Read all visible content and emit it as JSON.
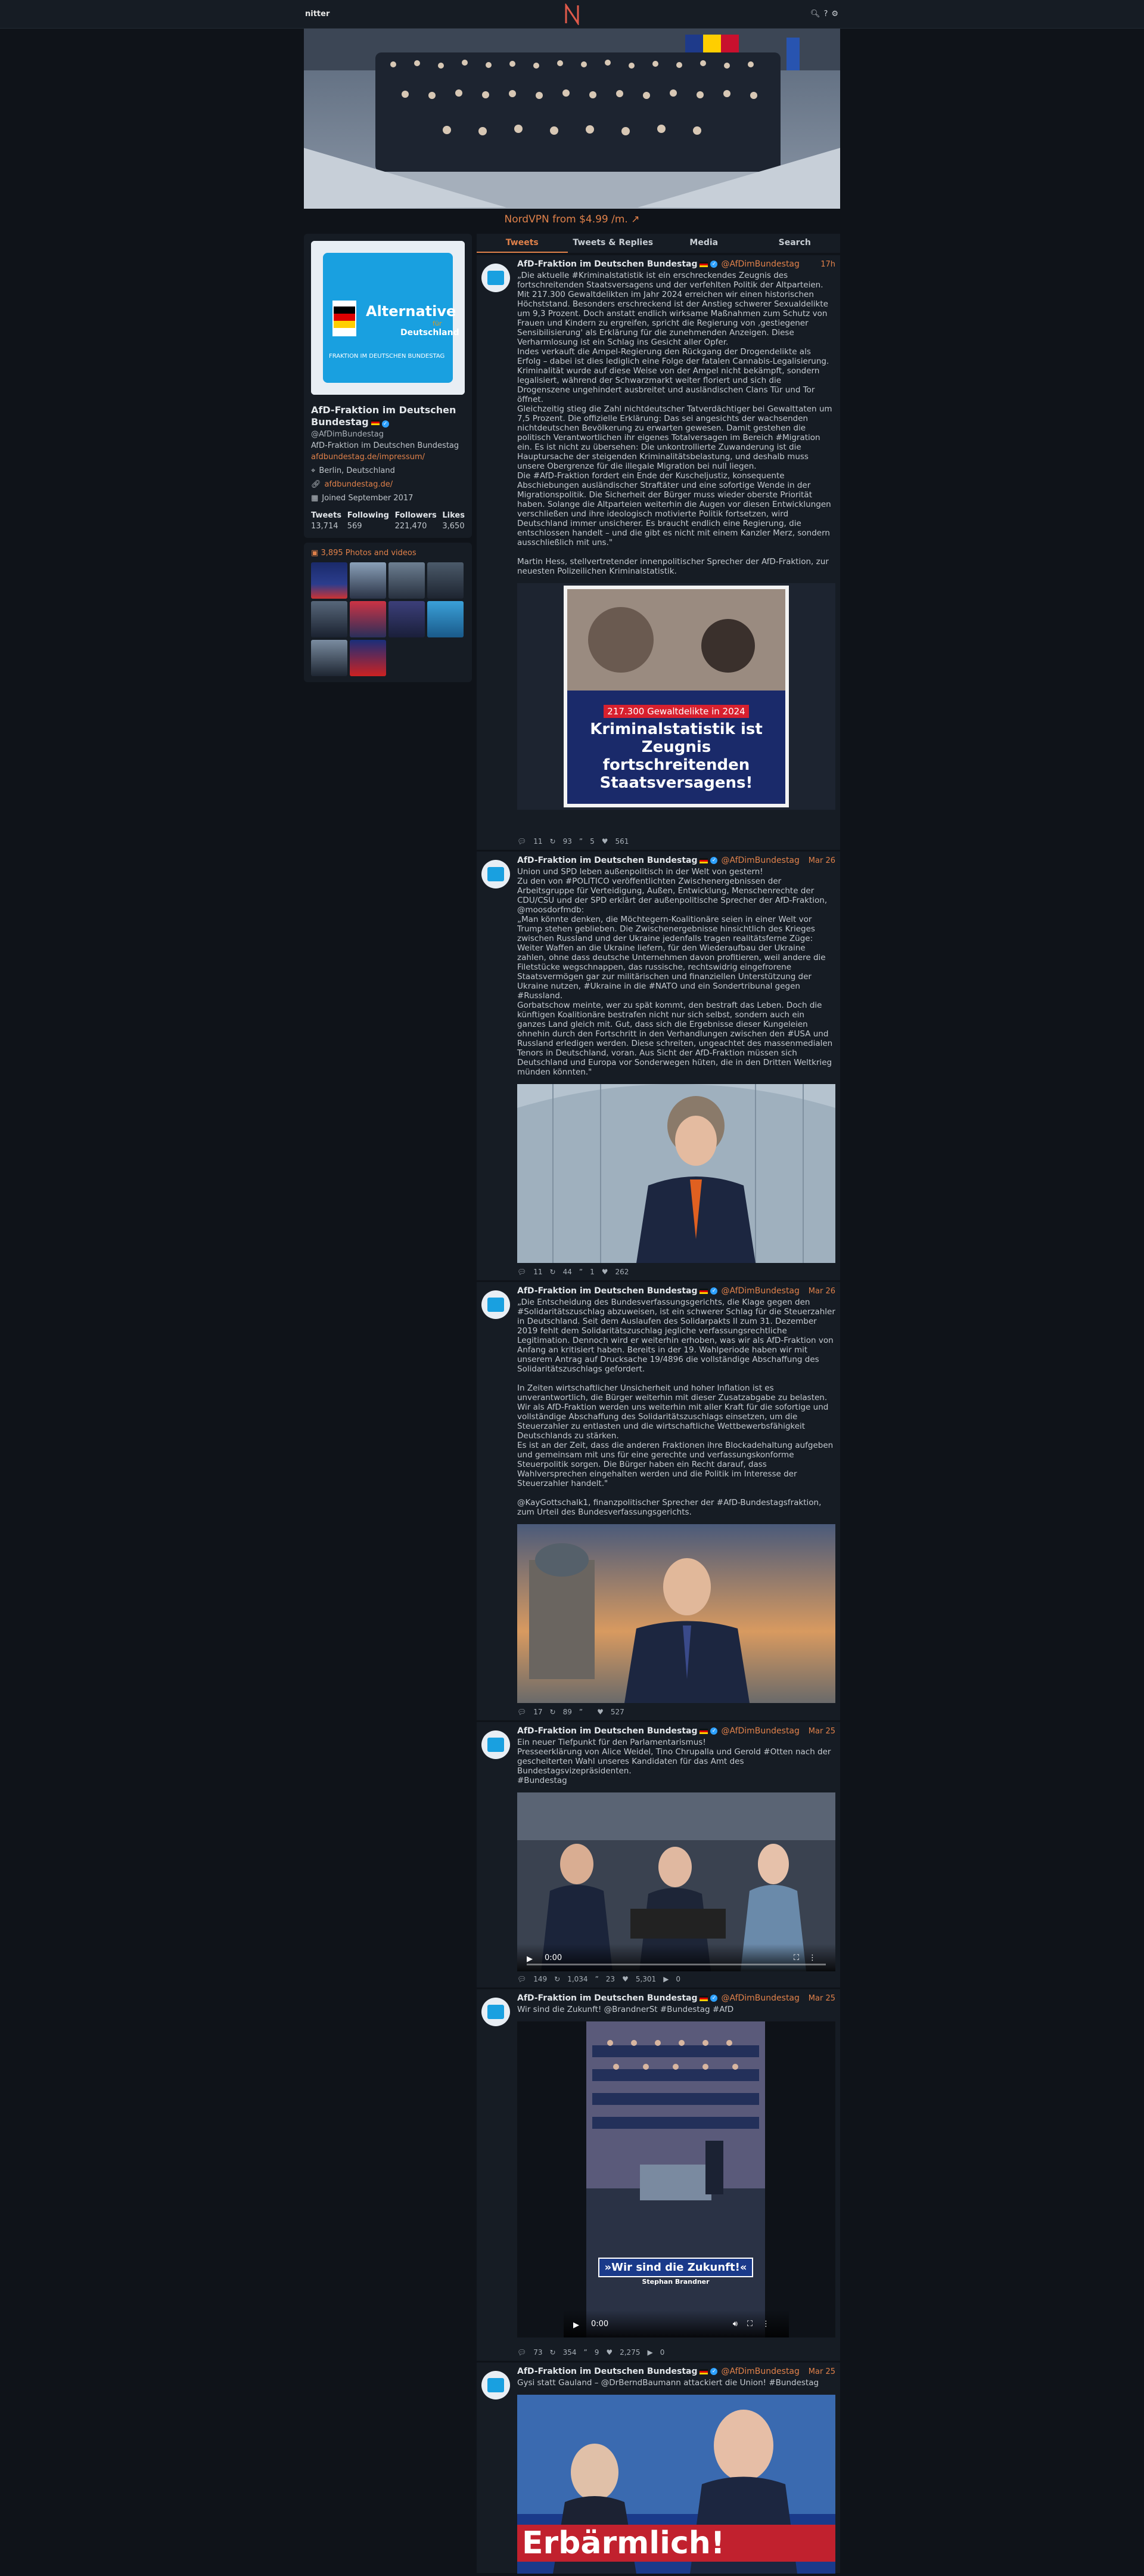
{
  "nav": {
    "brand": "nitter",
    "logo": "N",
    "icons": [
      "search-icon",
      "help-icon",
      "settings-icon"
    ]
  },
  "ad": {
    "text": "NordVPN from $4.99 /m.",
    "icon": "external-link-icon"
  },
  "profile": {
    "name": "AfD-Fraktion im Deutschen Bundestag",
    "handle": "@AfDimBundestag",
    "bio": "AfD-Fraktion im Deutschen Bundestag",
    "bio_link": "afdbundestag.de/impressum/",
    "location": "Berlin, Deutschland",
    "website": "afdbundestag.de/",
    "joined": "Joined September 2017",
    "stats": [
      {
        "label": "Tweets",
        "value": "13,714"
      },
      {
        "label": "Following",
        "value": "569"
      },
      {
        "label": "Followers",
        "value": "221,470"
      },
      {
        "label": "Likes",
        "value": "3,650"
      }
    ],
    "avatar_text": {
      "line1": "Alternative",
      "line2": "für",
      "line3": "Deutschland",
      "footer": "FRAKTION IM DEUTSCHEN BUNDESTAG"
    }
  },
  "media": {
    "title": "3,895 Photos and videos"
  },
  "tabs": [
    "Tweets",
    "Tweets & Replies",
    "Media",
    "Search"
  ],
  "colors": {
    "accent": "#e0814a",
    "bg": "#0f1319",
    "panel": "#161c24"
  },
  "tweets": [
    {
      "name": "AfD-Fraktion im Deutschen Bundestag",
      "handle": "@AfDimBundestag",
      "date": "17h",
      "text": "„Die aktuelle #Kriminalstatistik ist ein erschreckendes Zeugnis des fortschreitenden Staatsversagens und der verfehlten Politik der Altparteien. Mit 217.300 Gewaltdelikten im Jahr 2024 erreichen wir einen historischen Höchststand. Besonders erschreckend ist der Anstieg schwerer Sexualdelikte um 9,3 Prozent. Doch anstatt endlich wirksame Maßnahmen zum Schutz von Frauen und Kindern zu ergreifen, spricht die Regierung von ‚gestiegener Sensibilisierung' als Erklärung für die zunehmenden Anzeigen. Diese Verharmlosung ist ein Schlag ins Gesicht aller Opfer.\nIndes verkauft die Ampel-Regierung den Rückgang der Drogendelikte als Erfolg – dabei ist dies lediglich eine Folge der fatalen Cannabis-Legalisierung. Kriminalität wurde auf diese Weise von der Ampel nicht bekämpft, sondern legalisiert, während der Schwarzmarkt weiter floriert und sich die Drogenszene ungehindert ausbreitet und ausländischen Clans Tür und Tor öffnet.\nGleichzeitig stieg die Zahl nichtdeutscher Tatverdächtiger bei Gewalttaten um 7,5 Prozent. Die offizielle Erklärung: Das sei angesichts der wachsenden nichtdeutschen Bevölkerung zu erwarten gewesen. Damit gestehen die politisch Verantwortlichen ihr eigenes Totalversagen im Bereich #Migration ein. Es ist nicht zu übersehen: Die unkontrollierte Zuwanderung ist die Hauptursache der steigenden Kriminalitätsbelastung, und deshalb muss unsere Obergrenze für die illegale Migration bei null liegen.\nDie #AfD-Fraktion fordert ein Ende der Kuscheljustiz, konsequente Abschiebungen ausländischer Straftäter und eine sofortige Wende in der Migrationspolitik. Die Sicherheit der Bürger muss wieder oberste Priorität haben. Solange die Altparteien weiterhin die Augen vor diesen Entwicklungen verschließen und ihre ideologisch motivierte Politik fortsetzen, wird Deutschland immer unsicherer. Es braucht endlich eine Regierung, die entschlossen handelt – und die gibt es nicht mit einem Kanzler Merz, sondern ausschließlich mit uns.\"\n\nMartin Hess, stellvertretender innenpolitischer Sprecher der AfD-Fraktion, zur neuesten Polizeilichen Kriminalstatistik.",
      "media_caption": {
        "tag": "217.300 Gewaltdelikte in 2024",
        "headline": "Kriminalstatistik ist Zeugnis fortschreitenden Staatsversagens!"
      },
      "stats": {
        "replies": "11",
        "retweets": "93",
        "quotes": "5",
        "likes": "561"
      }
    },
    {
      "name": "AfD-Fraktion im Deutschen Bundestag",
      "handle": "@AfDimBundestag",
      "date": "Mar 26",
      "text": "Union und SPD leben außenpolitisch in der Welt von gestern!\nZu den von #POLITICO veröffentlichten Zwischenergebnissen der Arbeitsgruppe für Verteidigung, Außen, Entwicklung, Menschenrechte der CDU/CSU und der SPD erklärt der außenpolitische Sprecher der AfD-Fraktion, @moosdorfmdb:\n„Man könnte denken, die Möchtegern-Koalitionäre seien in einer Welt vor Trump stehen geblieben. Die Zwischenergebnisse hinsichtlich des Krieges zwischen Russland und der Ukraine jedenfalls tragen realitätsferne Züge: Weiter Waffen an die Ukraine liefern, für den Wiederaufbau der Ukraine zahlen, ohne dass deutsche Unternehmen davon profitieren, weil andere die Filetstücke wegschnappen, das russische, rechtswidrig eingefrorene Staatsvermögen gar zur militärischen und finanziellen Unterstützung der Ukraine nutzen, #Ukraine in die #NATO und ein Sondertribunal gegen #Russland.\nGorbatschow meinte, wer zu spät kommt, den bestraft das Leben. Doch die künftigen Koalitionäre bestrafen nicht nur sich selbst, sondern auch ein ganzes Land gleich mit. Gut, dass sich die Ergebnisse dieser Kungeleien ohnehin durch den Fortschritt in den Verhandlungen zwischen den #USA und Russland erledigen werden. Diese schreiten, ungeachtet des massenmedialen Tenors in Deutschland, voran. Aus Sicht der AfD-Fraktion müssen sich Deutschland und Europa vor Sonderwegen hüten, die in den Dritten Weltkrieg münden könnten.\"",
      "stats": {
        "replies": "11",
        "retweets": "44",
        "quotes": "1",
        "likes": "262"
      }
    },
    {
      "name": "AfD-Fraktion im Deutschen Bundestag",
      "handle": "@AfDimBundestag",
      "date": "Mar 26",
      "text": "„Die Entscheidung des Bundesverfassungsgerichts, die Klage gegen den #Solidaritätszuschlag abzuweisen, ist ein schwerer Schlag für die Steuerzahler in Deutschland. Seit dem Auslaufen des Solidarpakts II zum 31. Dezember 2019 fehlt dem Solidaritätszuschlag jegliche verfassungsrechtliche Legitimation. Dennoch wird er weiterhin erhoben, was wir als AfD-Fraktion von Anfang an kritisiert haben. Bereits in der 19. Wahlperiode haben wir mit unserem Antrag auf Drucksache 19/4896 die vollständige Abschaffung des Solidaritätszuschlags gefordert.\n\nIn Zeiten wirtschaftlicher Unsicherheit und hoher Inflation ist es unverantwortlich, die Bürger weiterhin mit dieser Zusatzabgabe zu belasten. Wir als AfD-Fraktion werden uns weiterhin mit aller Kraft für die sofortige und vollständige Abschaffung des Solidaritätszuschlags einsetzen, um die Steuerzahler zu entlasten und die wirtschaftliche Wettbewerbsfähigkeit Deutschlands zu stärken.\nEs ist an der Zeit, dass die anderen Fraktionen ihre Blockadehaltung aufgeben und gemeinsam mit uns für eine gerechte und verfassungskonforme Steuerpolitik sorgen. Die Bürger haben ein Recht darauf, dass Wahlversprechen eingehalten werden und die Politik im Interesse der Steuerzahler handelt.\"\n\n@KayGottschalk1, finanzpolitischer Sprecher der #AfD-Bundestagsfraktion, zum Urteil des Bundesverfassungsgerichts.",
      "stats": {
        "replies": "17",
        "retweets": "89",
        "quotes": "",
        "likes": "527"
      }
    },
    {
      "name": "AfD-Fraktion im Deutschen Bundestag",
      "handle": "@AfDimBundestag",
      "date": "Mar 25",
      "text": "Ein neuer Tiefpunkt für den Parlamentarismus!\nPresseerklärung von Alice Weidel, Tino Chrupalla und Gerold #Otten nach der gescheiterten Wahl unseres Kandidaten für das Amt des Bundestagsvizepräsidenten.\n#Bundestag",
      "video_time": "0:00",
      "stats": {
        "replies": "149",
        "retweets": "1,034",
        "quotes": "23",
        "likes": "5,301",
        "views": "0"
      }
    },
    {
      "name": "AfD-Fraktion im Deutschen Bundestag",
      "handle": "@AfDimBundestag",
      "date": "Mar 25",
      "text": "Wir sind die Zukunft! @BrandnerSt #Bundestag #AfD",
      "video_time": "0:00",
      "media_caption": {
        "headline": "»Wir sind die Zukunft!«",
        "sub": "Stephan Brandner"
      },
      "stats": {
        "replies": "73",
        "retweets": "354",
        "quotes": "9",
        "likes": "2,275",
        "views": "0"
      }
    },
    {
      "name": "AfD-Fraktion im Deutschen Bundestag",
      "handle": "@AfDimBundestag",
      "date": "Mar 25",
      "text": "Gysi statt Gauland – @DrBerndBaumann attackiert die Union! #Bundestag",
      "media_caption": {
        "headline": "Erbärmlich!"
      }
    }
  ]
}
